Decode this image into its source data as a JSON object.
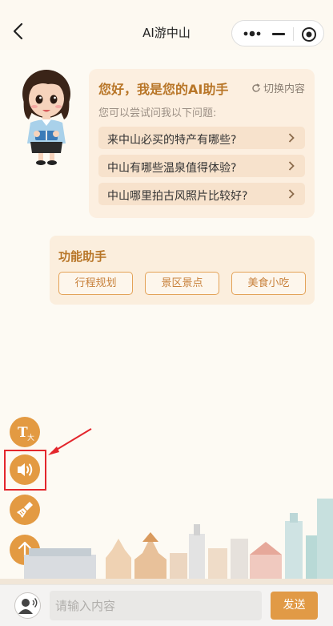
{
  "header": {
    "title": "AI游中山"
  },
  "greeting": {
    "title": "您好，我是您的AI助手",
    "switch_label": "切换内容",
    "hint": "您可以尝试问我以下问题:",
    "questions": [
      "来中山必买的特产有哪些?",
      "中山有哪些温泉值得体验?",
      "中山哪里拍古风照片比较好?"
    ]
  },
  "functions": {
    "title": "功能助手",
    "buttons": [
      "行程规划",
      "景区景点",
      "美食小吃"
    ]
  },
  "tools": {
    "font_size_glyph": "T",
    "font_size_sub": "大"
  },
  "input": {
    "placeholder": "请输入内容",
    "send_label": "发送"
  },
  "colors": {
    "accent": "#e39a42",
    "title_brown": "#b87628",
    "card_bg": "#fcefe0",
    "highlight_red": "#e3262c"
  }
}
